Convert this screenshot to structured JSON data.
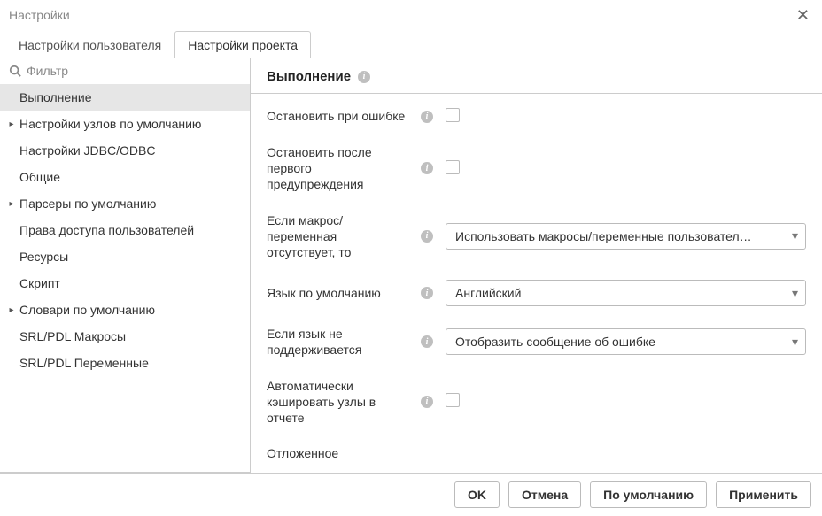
{
  "window": {
    "title": "Настройки"
  },
  "tabs": {
    "user": "Настройки пользователя",
    "project": "Настройки проекта"
  },
  "sidebar": {
    "filter_placeholder": "Фильтр",
    "items": [
      {
        "label": "Выполнение",
        "expandable": false,
        "selected": true
      },
      {
        "label": "Настройки узлов по умолчанию",
        "expandable": true,
        "selected": false
      },
      {
        "label": "Настройки JDBC/ODBC",
        "expandable": false,
        "selected": false
      },
      {
        "label": "Общие",
        "expandable": false,
        "selected": false
      },
      {
        "label": "Парсеры по умолчанию",
        "expandable": true,
        "selected": false
      },
      {
        "label": "Права доступа пользователей",
        "expandable": false,
        "selected": false
      },
      {
        "label": "Ресурсы",
        "expandable": false,
        "selected": false
      },
      {
        "label": "Скрипт",
        "expandable": false,
        "selected": false
      },
      {
        "label": "Словари по умолчанию",
        "expandable": true,
        "selected": false
      },
      {
        "label": "SRL/PDL Макросы",
        "expandable": false,
        "selected": false
      },
      {
        "label": "SRL/PDL Переменные",
        "expandable": false,
        "selected": false
      }
    ]
  },
  "panel": {
    "title": "Выполнение",
    "rows": {
      "stop_on_error": {
        "label": "Остановить при ошибке"
      },
      "stop_after_first_warning": {
        "label": "Остановить после первого предупреждения"
      },
      "macro_missing": {
        "label": "Если макрос/переменная отсутствует, то",
        "value": "Использовать макросы/переменные пользовател…"
      },
      "default_language": {
        "label": "Язык по умолчанию",
        "value": "Английский"
      },
      "language_unsupported": {
        "label": "Если язык не поддерживается",
        "value": "Отобразить сообщение об ошибке"
      },
      "auto_cache": {
        "label": "Автоматически кэшировать узлы в отчете"
      },
      "deferred": {
        "label": "Отложенное"
      }
    }
  },
  "footer": {
    "ok": "OK",
    "cancel": "Отмена",
    "defaults": "По умолчанию",
    "apply": "Применить"
  }
}
